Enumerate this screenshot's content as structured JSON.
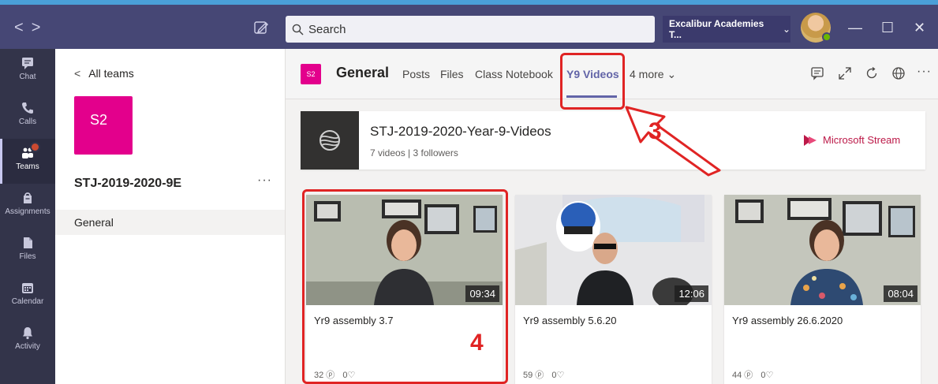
{
  "titlebar": {
    "search_placeholder": "Search",
    "org_name": "Excalibur Academies T...",
    "org_chevron": "⌄",
    "window_min": "—",
    "window_max": "☐",
    "window_close": "✕"
  },
  "rail": {
    "items": [
      {
        "label": "Chat",
        "icon": "chat-icon"
      },
      {
        "label": "Calls",
        "icon": "phone-icon"
      },
      {
        "label": "Teams",
        "icon": "teams-icon"
      },
      {
        "label": "Assignments",
        "icon": "assignments-icon"
      },
      {
        "label": "Files",
        "icon": "files-icon"
      },
      {
        "label": "Calendar",
        "icon": "calendar-icon"
      },
      {
        "label": "Activity",
        "icon": "bell-icon"
      }
    ]
  },
  "team": {
    "back_label": "All teams",
    "tile_initials": "S2",
    "name": "STJ-2019-2020-9E",
    "more": "···",
    "channels": [
      "General"
    ]
  },
  "channel": {
    "chip": "S2",
    "title": "General",
    "tabs": [
      "Posts",
      "Files",
      "Class Notebook",
      "Y9 Videos",
      "4 more"
    ],
    "active_tab": "Y9 Videos",
    "more_glyph": "···"
  },
  "stream": {
    "title": "STJ-2019-2020-Year-9-Videos",
    "stats": "7 videos | 3 followers",
    "brand": "Microsoft Stream",
    "brand_color": "#bc1948"
  },
  "videos": [
    {
      "title": "Yr9 assembly 3.7",
      "duration": "09:34",
      "views": "32",
      "likes": "0"
    },
    {
      "title": "Yr9 assembly 5.6.20",
      "duration": "12:06",
      "views": "59",
      "likes": "0"
    },
    {
      "title": "Yr9 assembly 26.6.2020",
      "duration": "08:04",
      "views": "44",
      "likes": "0"
    }
  ],
  "annotations": {
    "step_3": "3",
    "step_4": "4",
    "color": "#e02424"
  },
  "colors": {
    "teams_purple": "#6264a7",
    "titlebar": "#464775",
    "rail": "#33344a",
    "team_tile": "#e3008c"
  }
}
